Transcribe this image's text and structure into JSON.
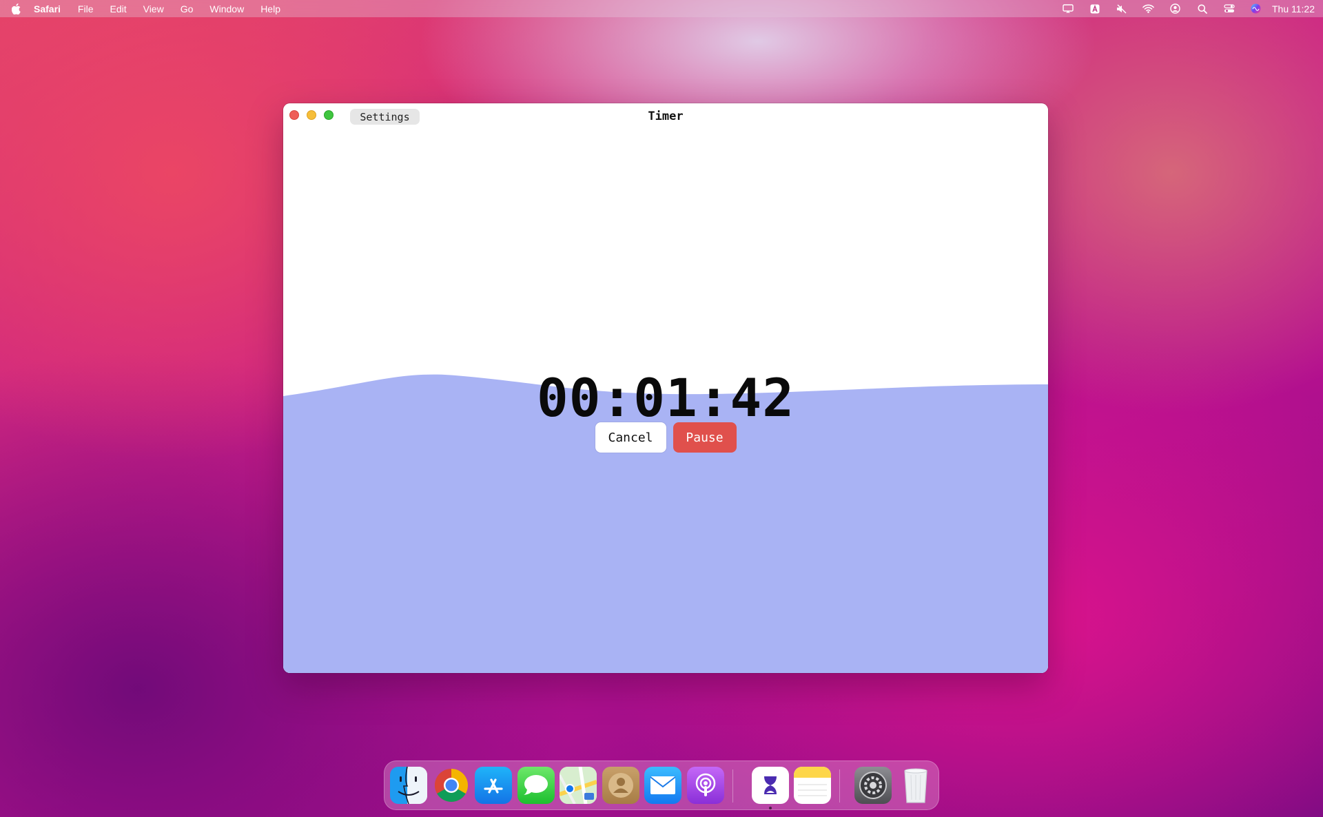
{
  "menubar": {
    "app_name": "Safari",
    "items": [
      "File",
      "Edit",
      "View",
      "Go",
      "Window",
      "Help"
    ],
    "clock": "Thu 11:22",
    "status_icons": [
      "airplay-icon",
      "input-source-icon",
      "mute-icon",
      "wifi-icon",
      "user-icon",
      "search-icon",
      "control-center-icon",
      "siri-icon"
    ]
  },
  "window": {
    "title": "Timer",
    "settings_label": "Settings"
  },
  "timer": {
    "time": "00:01:42",
    "cancel_label": "Cancel",
    "pause_label": "Pause",
    "wave_color": "#a9b3f4",
    "pause_color": "#e0504c"
  },
  "dock": {
    "apps": [
      "finder-icon",
      "chrome-icon",
      "app-store-icon",
      "messages-icon",
      "maps-icon",
      "contacts-icon",
      "mail-icon",
      "podcasts-icon",
      "timer-app-icon",
      "notes-icon",
      "system-preferences-icon",
      "trash-icon"
    ]
  }
}
